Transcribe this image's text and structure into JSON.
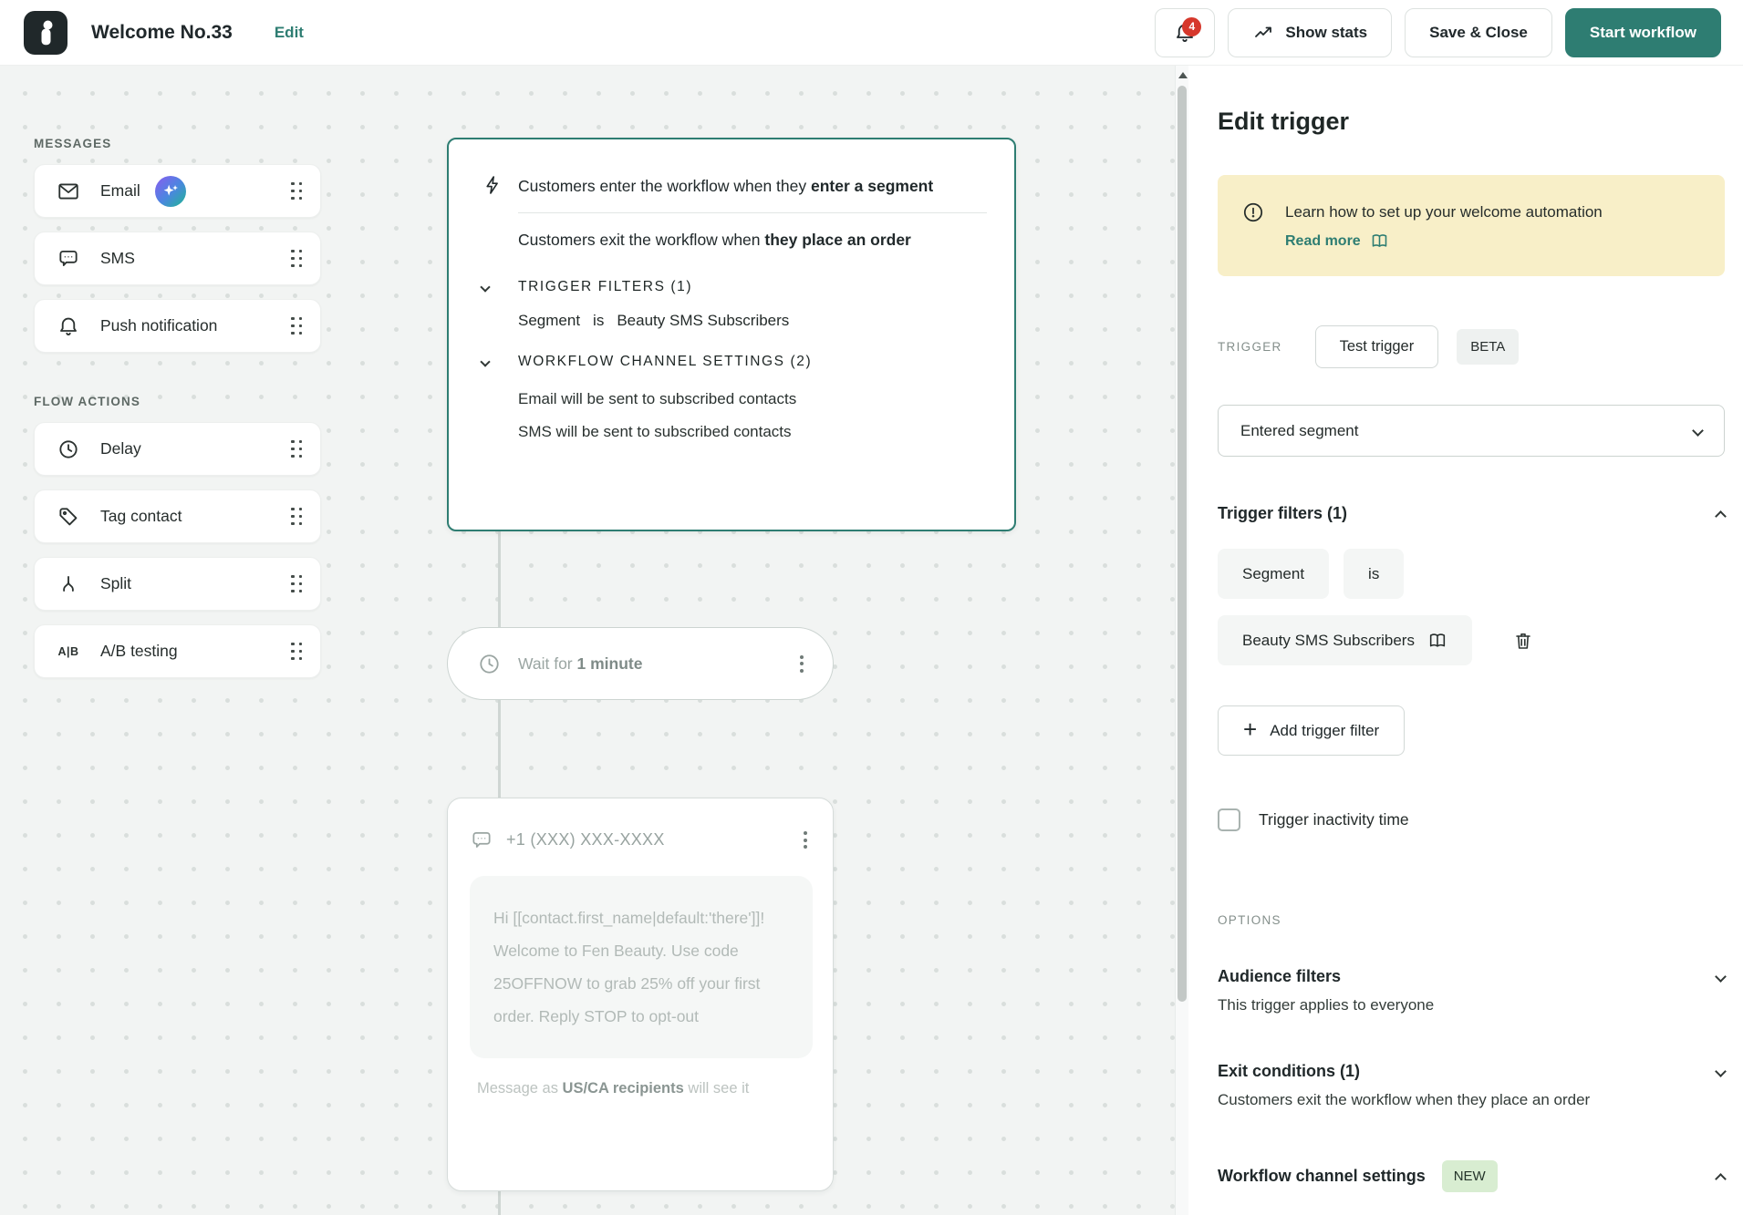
{
  "palette_colors": {
    "accent": "#2e7d72",
    "banner_bg": "#f8efc8",
    "badge_red": "#d6382c",
    "new_badge_bg": "#d8edd1",
    "canvas_bg": "#f2f4f3"
  },
  "header": {
    "title": "Welcome No.33",
    "edit_label": "Edit",
    "notification_count": "4",
    "show_stats_label": "Show stats",
    "save_close_label": "Save & Close",
    "start_workflow_label": "Start workflow"
  },
  "sidebar": {
    "messages_title": "MESSAGES",
    "messages": [
      {
        "label": "Email"
      },
      {
        "label": "SMS"
      },
      {
        "label": "Push notification"
      }
    ],
    "flow_actions_title": "FLOW ACTIONS",
    "flow_actions": [
      {
        "label": "Delay"
      },
      {
        "label": "Tag contact"
      },
      {
        "label": "Split"
      },
      {
        "label": "A/B testing"
      }
    ]
  },
  "canvas": {
    "trigger_card": {
      "enter_prefix": "Customers enter the workflow when they ",
      "enter_bold": "enter a segment",
      "exit_prefix": "Customers exit the workflow when ",
      "exit_bold": "they place an order",
      "filters_header": "TRIGGER FILTERS (1)",
      "filter_field": "Segment",
      "filter_operator": "is",
      "filter_value": "Beauty SMS Subscribers",
      "channel_header": "WORKFLOW CHANNEL SETTINGS (2)",
      "channel_line_email": "Email will be sent to subscribed contacts",
      "channel_line_sms": "SMS will be sent to subscribed contacts"
    },
    "wait_card": {
      "prefix": "Wait for ",
      "value": "1 minute"
    },
    "sms_card": {
      "recipient": "+1 (XXX) XXX-XXXX",
      "message": "Hi [[contact.first_name|default:'there']]! Welcome to Fen Beauty. Use code 25OFFNOW to grab 25% off your first order. Reply STOP to opt-out",
      "footer_prefix": "Message as ",
      "footer_bold": "US/CA recipients",
      "footer_suffix": " will see it"
    }
  },
  "panel": {
    "title": "Edit trigger",
    "banner": {
      "text": "Learn how to set up your welcome automation",
      "link_label": "Read more"
    },
    "trigger_label": "TRIGGER",
    "test_trigger_label": "Test trigger",
    "beta_label": "BETA",
    "trigger_select_value": "Entered segment",
    "filters": {
      "title": "Trigger filters (1)",
      "field": "Segment",
      "operator": "is",
      "value": "Beauty SMS Subscribers",
      "add_label": "Add trigger filter"
    },
    "inactivity_label": "Trigger inactivity time",
    "options_label": "OPTIONS",
    "audience": {
      "title": "Audience filters",
      "subtitle": "This trigger applies to everyone"
    },
    "exit": {
      "title": "Exit conditions (1)",
      "subtitle": "Customers exit the workflow when they place an order"
    },
    "channel": {
      "title": "Workflow channel settings",
      "badge": "NEW"
    }
  }
}
